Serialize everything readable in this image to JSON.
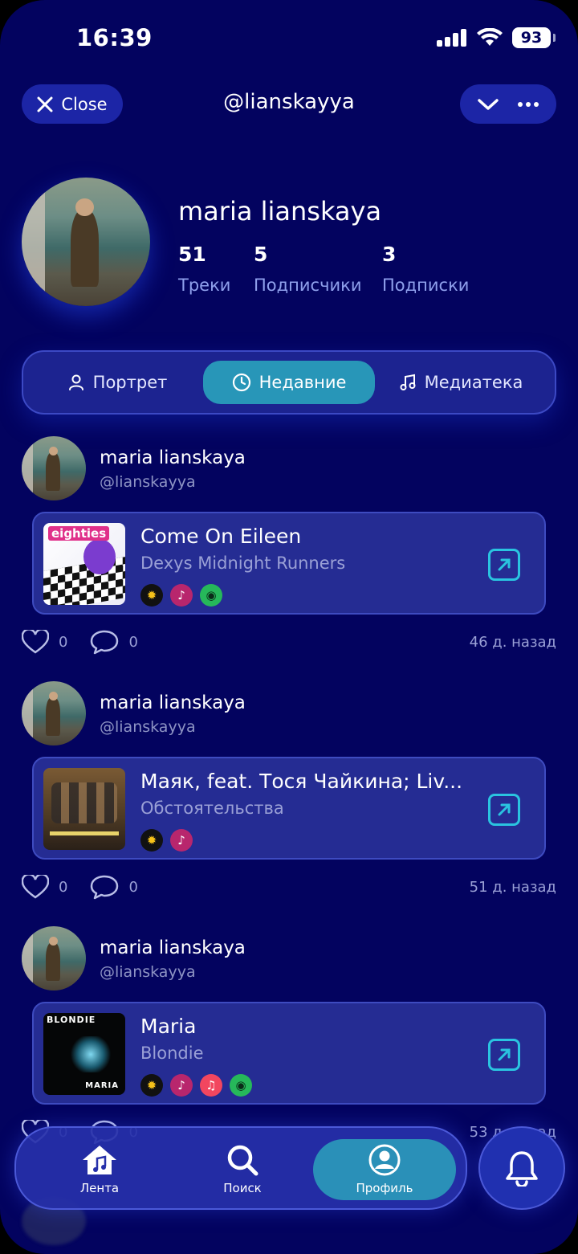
{
  "status_bar": {
    "time": "16:39",
    "battery": "93"
  },
  "header": {
    "close_label": "Close",
    "handle": "@lianskayya"
  },
  "profile": {
    "name": "maria lianskaya",
    "stats": [
      {
        "value": "51",
        "label": "Треки"
      },
      {
        "value": "5",
        "label": "Подписчики"
      },
      {
        "value": "3",
        "label": "Подписки"
      }
    ]
  },
  "tabs": [
    {
      "label": "Портрет",
      "icon": "person-icon",
      "active": false
    },
    {
      "label": "Недавние",
      "icon": "clock-icon",
      "active": true
    },
    {
      "label": "Медиатека",
      "icon": "music-note-icon",
      "active": false
    }
  ],
  "posts": [
    {
      "user": "maria lianskaya",
      "handle": "@lianskayya",
      "track": {
        "title": "Come On Eileen",
        "artist": "Dexys Midnight Runners",
        "cover_text": "eighties",
        "services": [
          "sun-service-icon",
          "lastfm-service-icon",
          "spotify-service-icon"
        ]
      },
      "likes": "0",
      "comments": "0",
      "time": "46 д. назад"
    },
    {
      "user": "maria lianskaya",
      "handle": "@lianskayya",
      "track": {
        "title": "Маяк, feat. Тося Чайкина; Liv...",
        "artist": "Обстоятельства",
        "services": [
          "sun-service-icon",
          "lastfm-service-icon"
        ]
      },
      "likes": "0",
      "comments": "0",
      "time": "51 д. назад"
    },
    {
      "user": "maria lianskaya",
      "handle": "@lianskayya",
      "track": {
        "title": "Maria",
        "artist": "Blondie",
        "cover_text_top": "BLONDIE",
        "cover_text_bottom": "MARIA",
        "services": [
          "sun-service-icon",
          "lastfm-service-icon",
          "apple-music-service-icon",
          "spotify-service-icon"
        ]
      },
      "likes": "0",
      "comments": "0",
      "time": "53 д. назад"
    }
  ],
  "bottom_nav": {
    "items": [
      {
        "label": "Лента",
        "icon": "home-music-icon"
      },
      {
        "label": "Поиск",
        "icon": "search-icon"
      },
      {
        "label": "Профиль",
        "icon": "profile-icon",
        "active": true
      }
    ],
    "notifications_icon": "bell-icon"
  },
  "colors": {
    "background": "#03035f",
    "accent": "#2896b8",
    "card": "#252c93",
    "open_icon": "#2ac4e0"
  }
}
